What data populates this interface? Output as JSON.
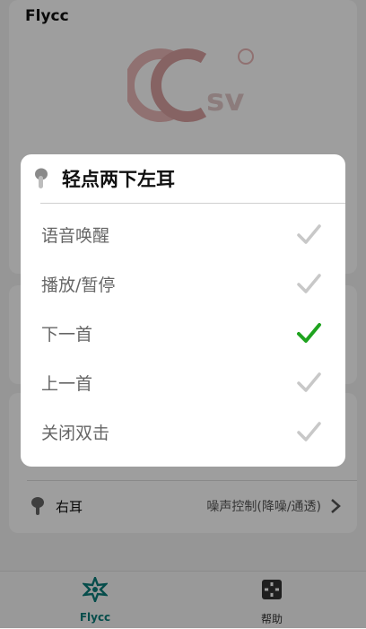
{
  "app": {
    "title": "Flycc"
  },
  "right_ear": {
    "label": "右耳",
    "value": "噪声控制(降噪/通透)"
  },
  "bottom_nav": [
    {
      "label": "Flycc",
      "icon": "flycc-star-icon",
      "active": true
    },
    {
      "label": "帮助",
      "icon": "help-icon",
      "active": false
    }
  ],
  "dialog": {
    "title": "轻点两下左耳",
    "options": [
      {
        "label": "语音唤醒",
        "selected": false
      },
      {
        "label": "播放/暂停",
        "selected": false
      },
      {
        "label": "下一首",
        "selected": true
      },
      {
        "label": "上一首",
        "selected": false
      },
      {
        "label": "关闭双击",
        "selected": false
      }
    ]
  },
  "colors": {
    "accent": "#0b7c7a",
    "check_selected": "#1fa31f",
    "check_unselected": "#c8c8c8"
  }
}
